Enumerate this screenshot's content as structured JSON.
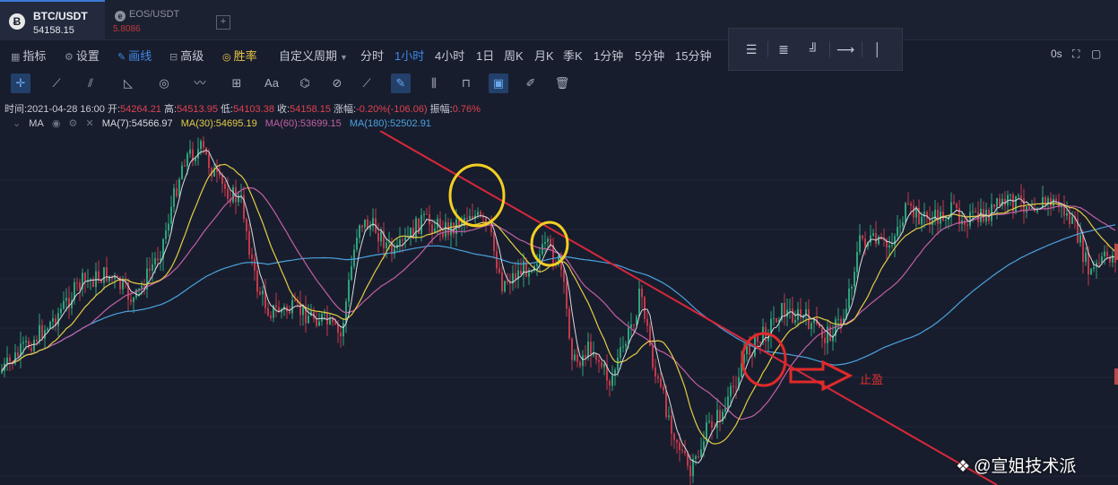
{
  "tabs": [
    {
      "icon": "bitcoin-icon",
      "glyph": "Ƀ",
      "pair": "BTC/USDT",
      "price": "54158.15"
    },
    {
      "icon": "eos-icon",
      "glyph": "e",
      "pair": "EOS/USDT",
      "price": "5.8086"
    }
  ],
  "add_tab": "+",
  "toolbar": {
    "indicators": "指标",
    "settings": "设置",
    "draw": "画线",
    "advanced": "高级",
    "winrate": "胜率",
    "custom_period": "自定义周期",
    "periods": [
      "分时",
      "1小时",
      "4小时",
      "1日",
      "周K",
      "月K",
      "季K",
      "1分钟",
      "5分钟",
      "15分钟"
    ],
    "active_period": "1小时",
    "seconds": "0s"
  },
  "info_bar": {
    "time_label": "时间:",
    "time": "2021-04-28 16:00",
    "open_label": "开:",
    "open": "54264.21",
    "high_label": "高:",
    "high": "54513.95",
    "low_label": "低:",
    "low": "54103.38",
    "close_label": "收:",
    "close": "54158.15",
    "change_label": "涨幅:",
    "change": "-0.20%(-106.06)",
    "amplitude_label": "振幅:",
    "amplitude": "0.76%"
  },
  "ma_legend": {
    "name": "MA",
    "ma7": "MA(7):54566.97",
    "ma30": "MA(30):54695.19",
    "ma60": "MA(60):53699.15",
    "ma180": "MA(180):52502.91"
  },
  "colors": {
    "background": "#181d2d",
    "up": "#2ea37a",
    "down": "#c2394a",
    "ma7": "#d9dbe0",
    "ma30": "#e3cc45",
    "ma60": "#c25fa5",
    "ma180": "#4aa3df",
    "trendline": "#d8283a",
    "annotation_yellow": "#f2cf24",
    "annotation_red": "#e02a2a"
  },
  "annotation": {
    "label": "止盈"
  },
  "watermark": "@宣姐技术派"
}
